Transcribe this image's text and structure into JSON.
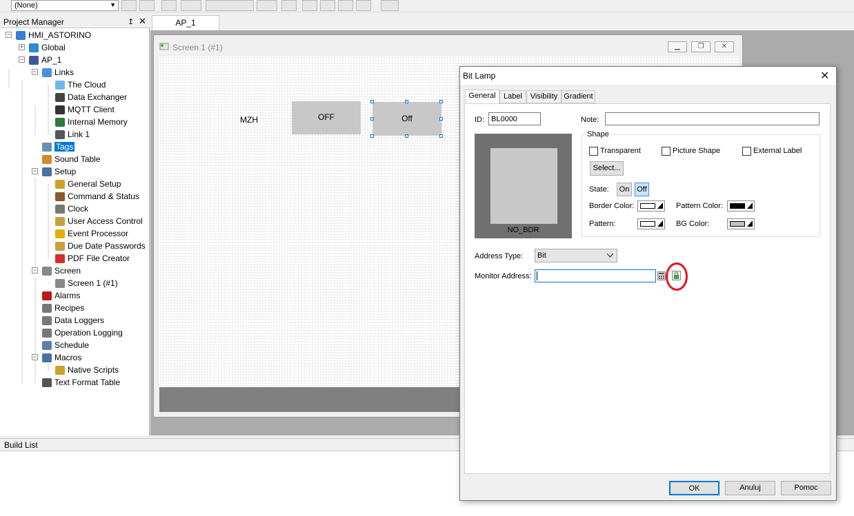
{
  "toolbar": {
    "style_value": "(None)"
  },
  "project_manager": {
    "title": "Project Manager",
    "pin": "↥",
    "close": "✕",
    "tree": [
      {
        "label": "HMI_ASTORINO",
        "icon": "project-icon",
        "color": "#3a7bd5"
      },
      {
        "label": "Global",
        "icon": "globe-icon",
        "color": "#2e8bcc"
      },
      {
        "label": "AP_1",
        "icon": "monitor-icon",
        "color": "#3c5a9a"
      },
      {
        "label": "Links",
        "icon": "links-icon",
        "color": "#4a90d9"
      },
      {
        "label": "The Cloud",
        "icon": "cloud-icon",
        "color": "#6fb6ea"
      },
      {
        "label": "Data Exchanger",
        "icon": "data-exchanger-icon",
        "color": "#444444"
      },
      {
        "label": "MQTT Client",
        "icon": "mqtt-icon",
        "color": "#333333"
      },
      {
        "label": "Internal Memory",
        "icon": "memory-icon",
        "color": "#2d7a3a"
      },
      {
        "label": "Link 1",
        "icon": "link-device-icon",
        "color": "#555555"
      },
      {
        "label": "Tags",
        "icon": "tags-icon",
        "color": "#6a8fb5"
      },
      {
        "label": "Sound Table",
        "icon": "sound-table-icon",
        "color": "#d08a2a"
      },
      {
        "label": "Setup",
        "icon": "setup-icon",
        "color": "#4a6fa5"
      },
      {
        "label": "General Setup",
        "icon": "general-setup-icon",
        "color": "#c9a227"
      },
      {
        "label": "Command & Status",
        "icon": "command-status-icon",
        "color": "#8a5a2a"
      },
      {
        "label": "Clock",
        "icon": "clock-icon",
        "color": "#777777"
      },
      {
        "label": "User Access Control",
        "icon": "user-access-icon",
        "color": "#c8a040"
      },
      {
        "label": "Event Processor",
        "icon": "event-processor-icon",
        "color": "#e0b000"
      },
      {
        "label": "Due Date Passwords",
        "icon": "due-date-icon",
        "color": "#c8a040"
      },
      {
        "label": "PDF File Creator",
        "icon": "pdf-icon",
        "color": "#d32f2f"
      },
      {
        "label": "Screen",
        "icon": "screen-folder-icon",
        "color": "#888888"
      },
      {
        "label": "Screen 1 (#1)",
        "icon": "screen-icon",
        "color": "#888888"
      },
      {
        "label": "Alarms",
        "icon": "alarms-icon",
        "color": "#b71c1c"
      },
      {
        "label": "Recipes",
        "icon": "recipes-icon",
        "color": "#777777"
      },
      {
        "label": "Data Loggers",
        "icon": "data-loggers-icon",
        "color": "#777777"
      },
      {
        "label": "Operation Logging",
        "icon": "operation-logging-icon",
        "color": "#777777"
      },
      {
        "label": "Schedule",
        "icon": "schedule-icon",
        "color": "#5a7fb0"
      },
      {
        "label": "Macros",
        "icon": "macros-icon",
        "color": "#4a6fa5"
      },
      {
        "label": "Native Scripts",
        "icon": "native-scripts-icon",
        "color": "#c9a227"
      },
      {
        "label": "Text Format Table",
        "icon": "text-format-icon",
        "color": "#555555"
      }
    ]
  },
  "doc_tab": "AP_1",
  "screen_window": {
    "title": "Screen 1 (#1)"
  },
  "canvas": {
    "label": "MZH",
    "lamp1": "OFF",
    "lamp2": "Off"
  },
  "build_list": {
    "title": "Build List"
  },
  "dialog": {
    "title": "Bit Lamp",
    "close": "✕",
    "tabs": [
      "General",
      "Label",
      "Visibility",
      "Gradient"
    ],
    "id_label": "ID:",
    "id_value": "BL0000",
    "note_label": "Note:",
    "note_value": "",
    "shape_group": "Shape",
    "transparent": "Transparent",
    "picture_shape": "Picture Shape",
    "external_label": "External Label",
    "select_button": "Select...",
    "state_label": "State:",
    "state_on": "On",
    "state_off": "Off",
    "border_color_label": "Border Color:",
    "pattern_color_label": "Pattern Color:",
    "pattern_label": "Pattern:",
    "bg_color_label": "BG Color:",
    "preview_label": "NO_BDR",
    "address_type_label": "Address Type:",
    "address_type_value": "Bit",
    "monitor_address_label": "Monitor Address:",
    "monitor_address_value": "",
    "ok": "OK",
    "cancel": "Anuluj",
    "help": "Pomoc",
    "colors": {
      "border": "#ffffff",
      "pattern_color": "#000000",
      "pattern": "#ffffff",
      "bg": "#c0c0c0"
    }
  }
}
